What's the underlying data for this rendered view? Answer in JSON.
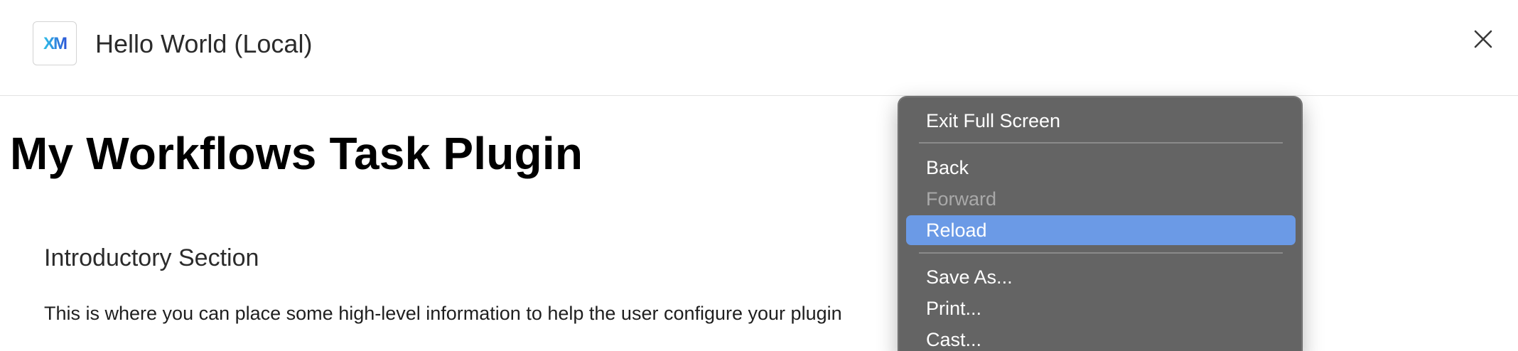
{
  "header": {
    "logo_text": "XM",
    "title": "Hello World (Local)",
    "close_icon": "close-icon"
  },
  "main": {
    "heading": "My Workflows Task Plugin",
    "section_title": "Introductory Section",
    "section_body": "This is where you can place some high-level information to help the user configure your plugin"
  },
  "context_menu": {
    "items": [
      {
        "label": "Exit Full Screen",
        "state": "normal"
      },
      {
        "label": "Back",
        "state": "normal"
      },
      {
        "label": "Forward",
        "state": "disabled"
      },
      {
        "label": "Reload",
        "state": "highlighted"
      },
      {
        "label": "Save As...",
        "state": "normal"
      },
      {
        "label": "Print...",
        "state": "normal"
      },
      {
        "label": "Cast...",
        "state": "normal"
      }
    ]
  },
  "colors": {
    "menu_background": "#646464",
    "menu_highlight": "#6b9ae6",
    "logo_gradient_start": "#2fa6e0",
    "logo_gradient_end": "#2d5bd8"
  }
}
